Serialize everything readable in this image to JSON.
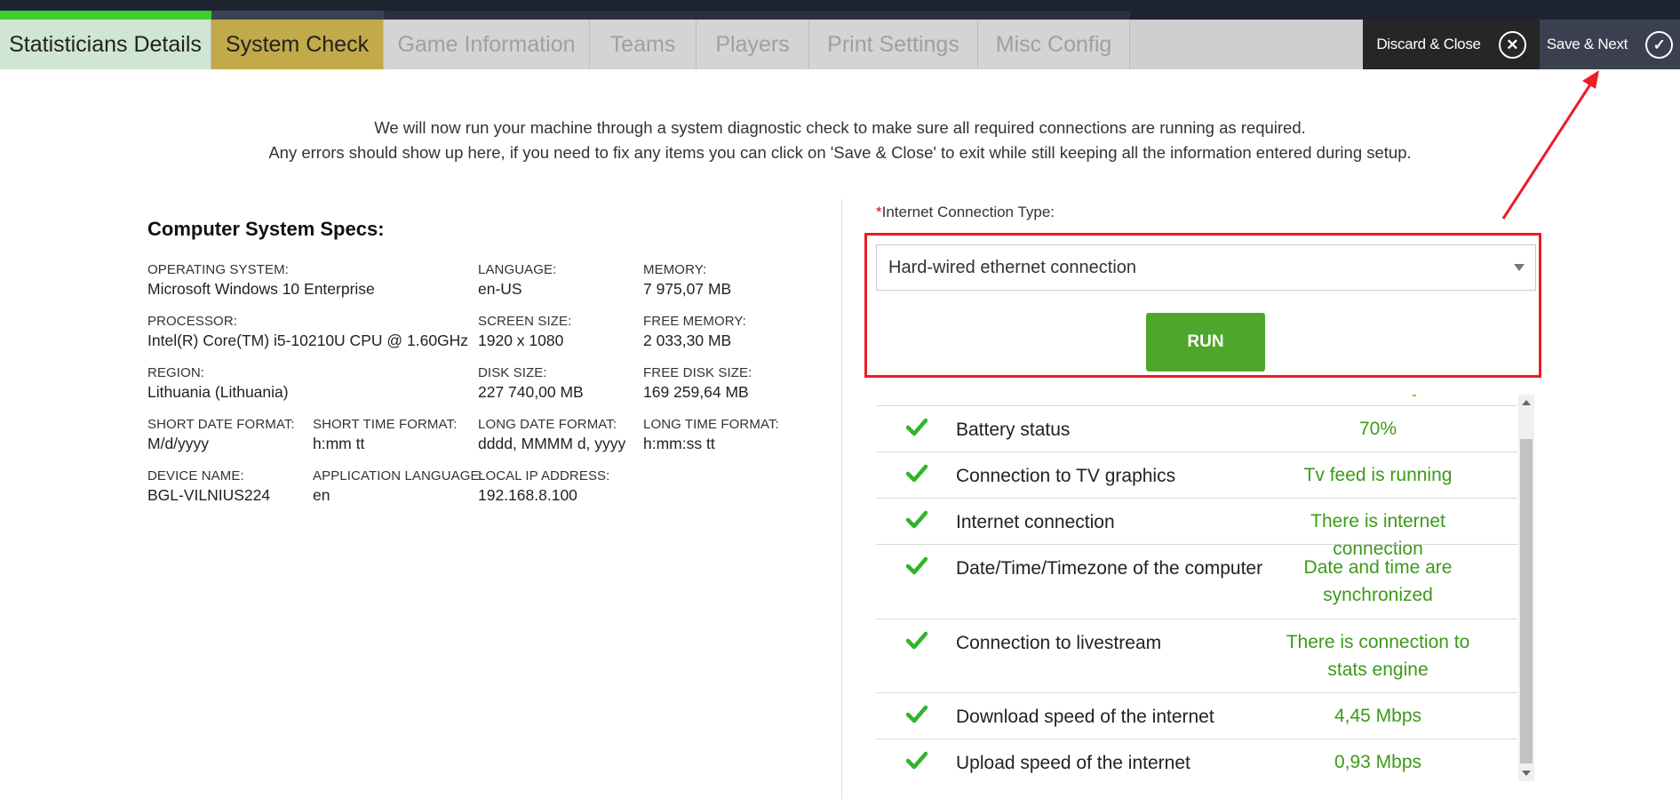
{
  "colors": {
    "accent_green": "#3ecf2a",
    "active_tab": "#c2a94a",
    "done_tab": "#cfe6d2",
    "run_button": "#4ea62a",
    "ok_text": "#3c9a18",
    "annotation_red": "#ec1c24"
  },
  "tabs": [
    {
      "label": "Statisticians Details",
      "state": "done"
    },
    {
      "label": "System Check",
      "state": "active"
    },
    {
      "label": "Game Information",
      "state": "disabled"
    },
    {
      "label": "Teams",
      "state": "disabled"
    },
    {
      "label": "Players",
      "state": "disabled"
    },
    {
      "label": "Print Settings",
      "state": "disabled"
    },
    {
      "label": "Misc Config",
      "state": "disabled"
    }
  ],
  "actions": {
    "discard_label": "Discard & Close",
    "discard_icon": "close-icon",
    "save_next_label": "Save & Next",
    "save_next_icon": "checkmark-icon"
  },
  "intro": {
    "line1": "We will now run your machine through a system diagnostic check to make sure all required connections are running as required.",
    "line2": "Any errors should show up here, if you need to fix any items you can click on 'Save & Close' to exit while still keeping all the information entered during setup."
  },
  "specs": {
    "title": "Computer System Specs:",
    "items": [
      {
        "label": "OPERATING SYSTEM:",
        "value": "Microsoft Windows 10 Enterprise"
      },
      {
        "label": "LANGUAGE:",
        "value": "en-US"
      },
      {
        "label": "MEMORY:",
        "value": "7 975,07 MB"
      },
      {
        "label": "PROCESSOR:",
        "value": "Intel(R) Core(TM) i5-10210U CPU @ 1.60GHz"
      },
      {
        "label": "SCREEN SIZE:",
        "value": "1920 x 1080"
      },
      {
        "label": "FREE MEMORY:",
        "value": "2 033,30 MB"
      },
      {
        "label": "REGION:",
        "value": "Lithuania (Lithuania)"
      },
      {
        "label": "DISK SIZE:",
        "value": "227 740,00 MB"
      },
      {
        "label": "FREE DISK SIZE:",
        "value": "169 259,64 MB"
      },
      {
        "label": "SHORT DATE FORMAT:",
        "value": "M/d/yyyy"
      },
      {
        "label": "SHORT TIME FORMAT:",
        "value": "h:mm tt"
      },
      {
        "label": "LONG DATE FORMAT:",
        "value": "dddd, MMMM d, yyyy"
      },
      {
        "label": "LONG TIME FORMAT:",
        "value": "h:mm:ss tt"
      },
      {
        "label": "DEVICE NAME:",
        "value": "BGL-VILNIUS224"
      },
      {
        "label": "APPLICATION LANGUAGE:",
        "value": "en"
      },
      {
        "label": "LOCAL IP ADDRESS:",
        "value": "192.168.8.100"
      }
    ]
  },
  "connection": {
    "required_mark": "*",
    "label": "Internet Connection Type:",
    "selected": "Hard-wired ethernet connection",
    "run_label": "RUN"
  },
  "checks": [
    {
      "name": "Battery status",
      "result": "70%",
      "status_icon": "checkmark-icon"
    },
    {
      "name": "Connection to TV graphics",
      "result": "Tv feed is running",
      "status_icon": "checkmark-icon"
    },
    {
      "name": "Internet connection",
      "result": "There is internet connection",
      "status_icon": "checkmark-icon"
    },
    {
      "name": "Date/Time/Timezone of the computer",
      "result": "Date and time are synchronized",
      "status_icon": "checkmark-icon"
    },
    {
      "name": "Connection to livestream",
      "result": "There is connection to stats engine",
      "status_icon": "checkmark-icon"
    },
    {
      "name": "Download speed of the internet",
      "result": "4,45 Mbps",
      "status_icon": "checkmark-icon"
    },
    {
      "name": "Upload speed of the internet",
      "result": "0,93 Mbps",
      "status_icon": "checkmark-icon"
    }
  ]
}
